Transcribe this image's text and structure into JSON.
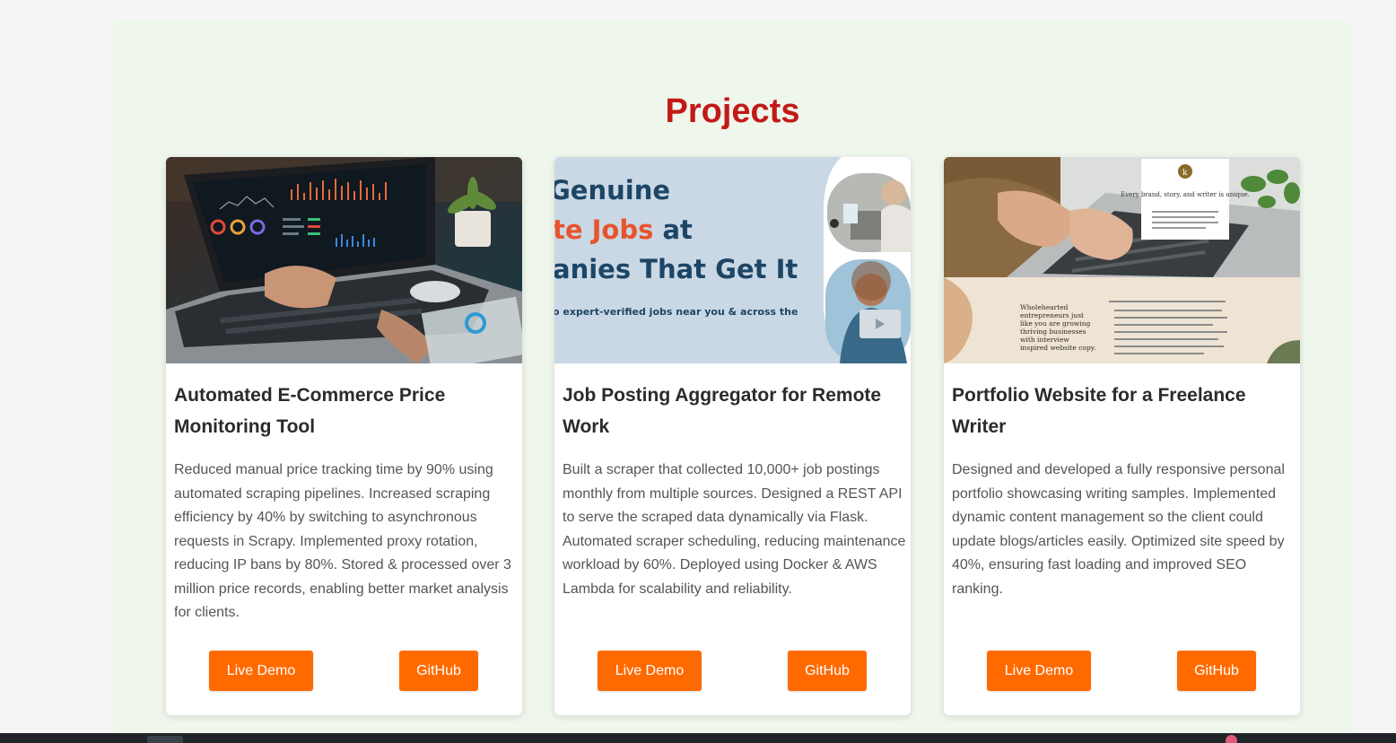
{
  "section": {
    "title": "Projects"
  },
  "projects": [
    {
      "title": "Automated E-Commerce Price Monitoring Tool",
      "description": "Reduced manual price tracking time by 90% using automated scraping pipelines. Increased scraping efficiency by 40% by switching to asynchronous requests in Scrapy. Implemented proxy rotation, reducing IP bans by 80%. Stored & processed over 3 million price records, enabling better market analysis for clients.",
      "demo_label": "Live Demo",
      "github_label": "GitHub"
    },
    {
      "title": "Job Posting Aggregator for Remote Work",
      "description": "Built a scraper that collected 10,000+ job postings monthly from multiple sources. Designed a REST API to serve the scraped data dynamically via Flask. Automated scraper scheduling, reducing maintenance workload by 60%. Deployed using Docker & AWS Lambda for scalability and reliability.",
      "demo_label": "Live Demo",
      "github_label": "GitHub",
      "image_text": {
        "line1": "Genuine",
        "line2_accent": "te Jobs",
        "line2_rest": " at",
        "line3": "anies That Get It",
        "line4": "o expert-verified jobs near you & across the"
      }
    },
    {
      "title": "Portfolio Website for a Freelance Writer",
      "description": "Designed and developed a fully responsive personal portfolio showcasing writing samples. Implemented dynamic content management so the client could update blogs/articles easily. Optimized site speed by 40%, ensuring fast loading and improved SEO ranking.",
      "demo_label": "Live Demo",
      "github_label": "GitHub",
      "image_text": {
        "logo_letter": "k",
        "card_heading": "Every brand, story, and writer is unique.",
        "side_text": [
          "Wholehearted",
          "entrepreneurs just",
          "like you are growing",
          "thriving businesses",
          "with interview",
          "inspired website copy."
        ]
      }
    }
  ],
  "colors": {
    "accent_title": "#c21a17",
    "button": "#ff6a00",
    "section_bg": "#eff6ec",
    "job_accent": "#e8542c",
    "job_navy": "#1d4566"
  }
}
